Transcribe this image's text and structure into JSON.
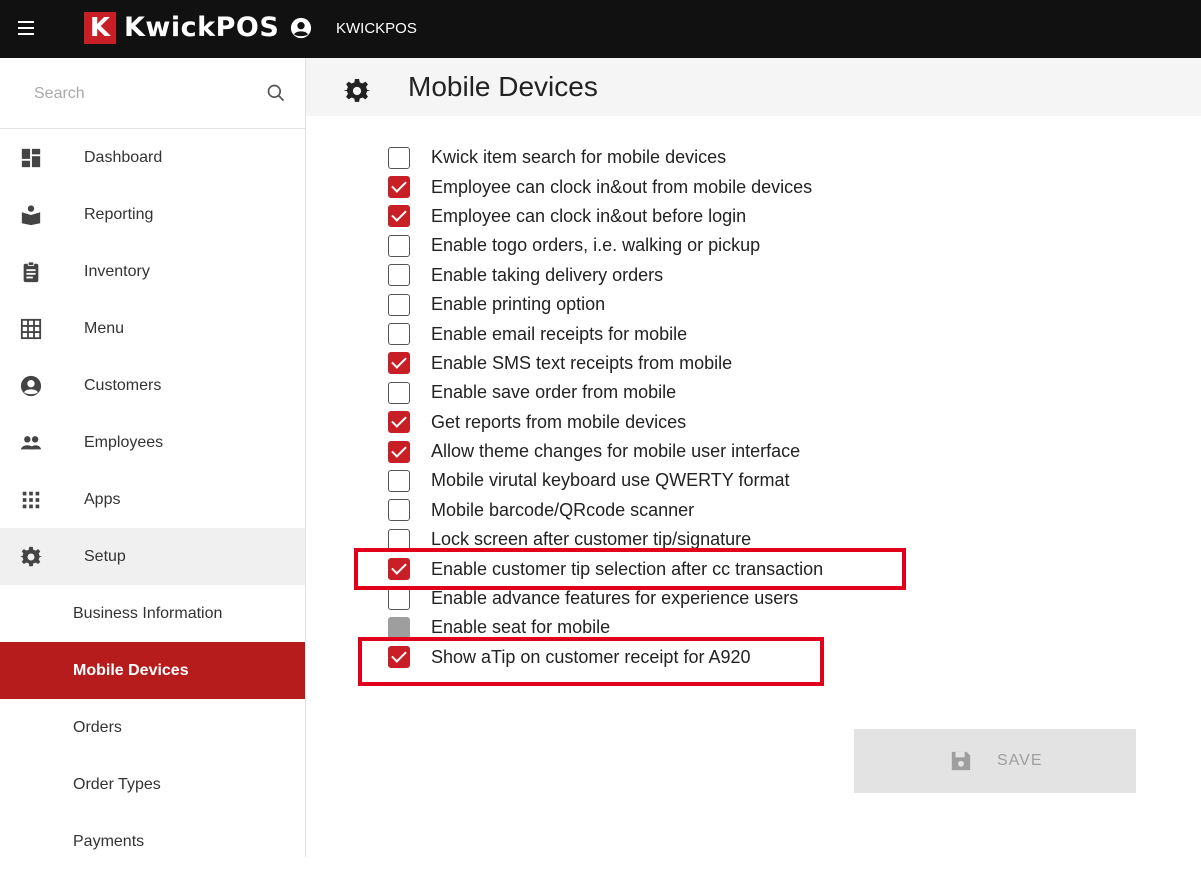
{
  "header": {
    "logo_letter": "K",
    "brand": "KwickPOS",
    "user": "KWICKPOS"
  },
  "search": {
    "placeholder": "Search"
  },
  "nav": [
    {
      "label": "Dashboard",
      "icon": "dashboard-icon"
    },
    {
      "label": "Reporting",
      "icon": "reporting-icon"
    },
    {
      "label": "Inventory",
      "icon": "clipboard-icon"
    },
    {
      "label": "Menu",
      "icon": "grid-icon"
    },
    {
      "label": "Customers",
      "icon": "user-circle-icon"
    },
    {
      "label": "Employees",
      "icon": "people-icon"
    },
    {
      "label": "Apps",
      "icon": "apps-icon"
    },
    {
      "label": "Setup",
      "icon": "gear-icon"
    }
  ],
  "setup_sub": [
    {
      "label": "Business Information"
    },
    {
      "label": "Mobile Devices",
      "selected": true
    },
    {
      "label": "Orders"
    },
    {
      "label": "Order Types"
    },
    {
      "label": "Payments"
    }
  ],
  "page": {
    "title": "Mobile Devices"
  },
  "options": [
    {
      "label": "Kwick item search for mobile devices",
      "state": "unchecked"
    },
    {
      "label": "Employee can clock in&out from mobile devices",
      "state": "checked"
    },
    {
      "label": "Employee can clock in&out before login",
      "state": "checked"
    },
    {
      "label": "Enable togo orders, i.e. walking or pickup",
      "state": "unchecked"
    },
    {
      "label": "Enable taking delivery orders",
      "state": "unchecked"
    },
    {
      "label": "Enable printing option",
      "state": "unchecked"
    },
    {
      "label": "Enable email receipts for mobile",
      "state": "unchecked"
    },
    {
      "label": "Enable SMS text receipts from mobile",
      "state": "checked"
    },
    {
      "label": "Enable save order from mobile",
      "state": "unchecked"
    },
    {
      "label": "Get reports from mobile devices",
      "state": "checked"
    },
    {
      "label": "Allow theme changes for mobile user interface",
      "state": "checked"
    },
    {
      "label": "Mobile virutal keyboard use QWERTY format",
      "state": "unchecked"
    },
    {
      "label": "Mobile barcode/QRcode scanner",
      "state": "unchecked"
    },
    {
      "label": "Lock screen after customer tip/signature",
      "state": "unchecked"
    },
    {
      "label": "Enable customer tip selection after cc transaction",
      "state": "checked"
    },
    {
      "label": "Enable advance features for experience users",
      "state": "unchecked"
    },
    {
      "label": "Enable seat for mobile",
      "state": "disabled"
    },
    {
      "label": "Show aTip on customer receipt for A920",
      "state": "checked"
    }
  ],
  "save": {
    "label": "SAVE"
  },
  "colors": {
    "brand_red": "#c81e25",
    "selected_bg": "#b71c1c",
    "highlight": "#e0001b"
  }
}
